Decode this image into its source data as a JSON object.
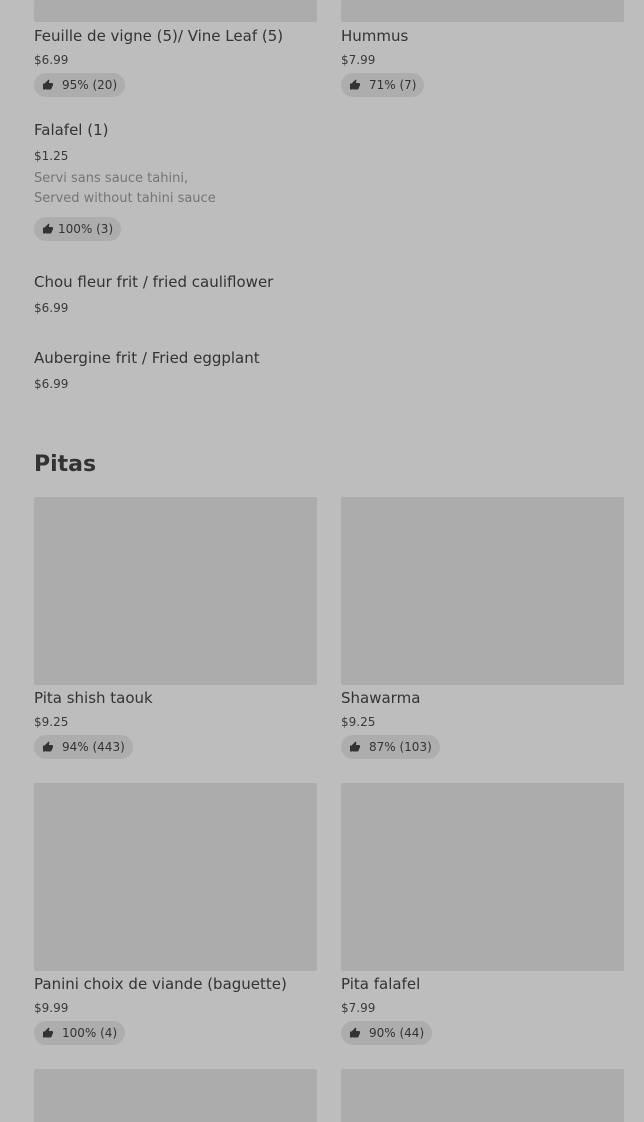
{
  "icons": {
    "rating": "thumbs-up-icon"
  },
  "colors": {
    "background": "#bdbdbd",
    "image_placeholder": "#acacac",
    "badge": "#adadad",
    "text": "#333333",
    "muted": "#757575"
  },
  "top_items": [
    {
      "name": "Feuille de vigne (5)/ Vine Leaf (5)",
      "price": "$6.99",
      "rating": "95% (20)"
    },
    {
      "name": "Hummus",
      "price": "$7.99",
      "rating": "71% (7)"
    }
  ],
  "list_items": [
    {
      "name": "Falafel (1)",
      "price": "$1.25",
      "desc_line1": "Servi sans sauce tahini,",
      "desc_line2": "Served without tahini sauce",
      "rating": "100% (3)"
    },
    {
      "name": "Chou fleur frit / fried cauliflower",
      "price": "$6.99"
    },
    {
      "name": "Aubergine frit / Fried eggplant",
      "price": "$6.99"
    }
  ],
  "section": {
    "title": "Pitas"
  },
  "pitas": [
    {
      "name": "Pita shish taouk",
      "price": "$9.25",
      "rating": "94% (443)"
    },
    {
      "name": "Shawarma",
      "price": "$9.25",
      "rating": "87% (103)"
    },
    {
      "name": "Panini choix de viande (baguette)",
      "price": "$9.99",
      "rating": "100% (4)"
    },
    {
      "name": "Pita falafel",
      "price": "$7.99",
      "rating": "90% (44)"
    }
  ]
}
